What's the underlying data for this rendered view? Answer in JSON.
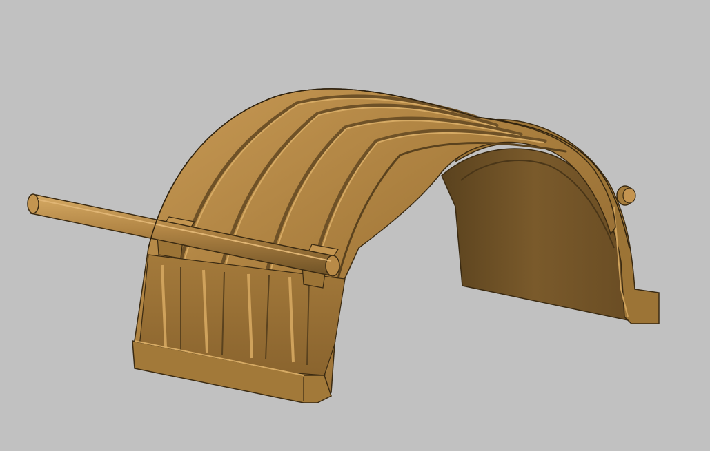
{
  "viewport": {
    "background": "#c1c1c1",
    "model": "fender-with-rod",
    "colors": {
      "base": "#a57c3c",
      "highlight": "#cfa25c",
      "shadow": "#6e5127",
      "deep_shadow": "#4a3618",
      "inner": "#7a5a2b",
      "edge": "#3a2a12"
    }
  }
}
